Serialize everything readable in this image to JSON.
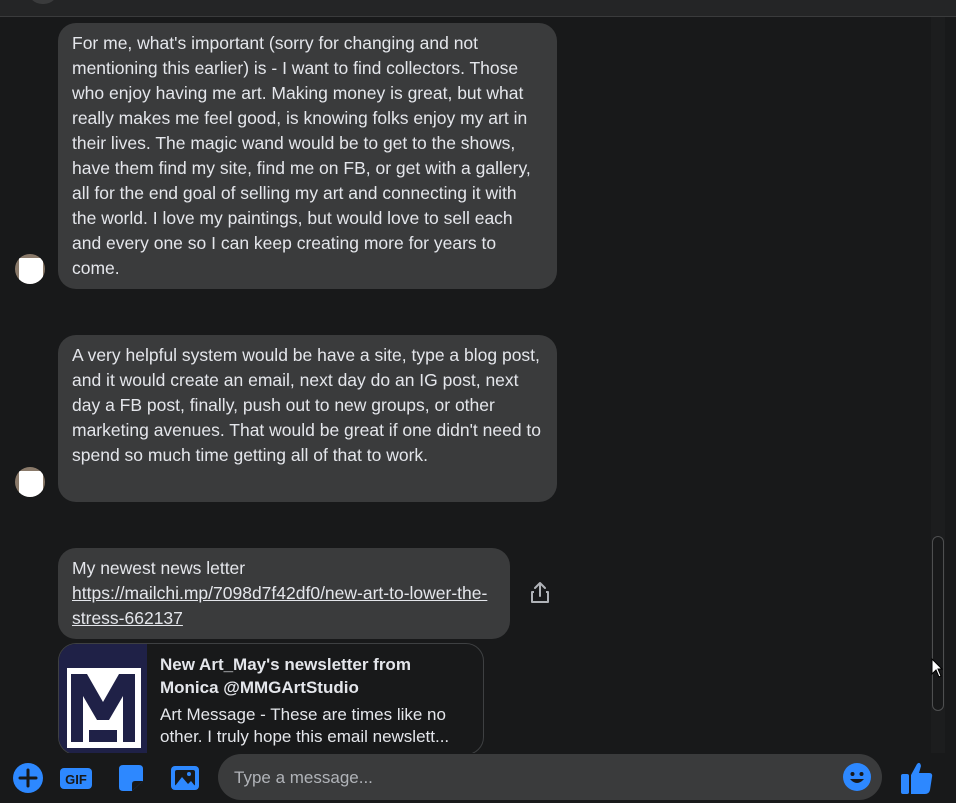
{
  "messages": [
    {
      "text": "For me, what's important (sorry for changing and not mentioning this earlier) is - I want to find collectors. Those who enjoy having me art. Making money is great, but what really makes me feel good, is knowing folks enjoy my art in their lives. The magic wand would be to get to the shows, have them find my site, find me on FB, or get with a gallery, all for the end goal of selling my art and connecting it with the world. I love my paintings, but would love to sell each and every one so I can keep creating more for years to come."
    },
    {
      "text": "A very helpful system would be have a site, type a blog post, and it would create an email, next day do an IG post, next day a FB post, finally, push out to new groups, or other marketing avenues. That would be great if one didn't need to spend so much time getting all of that to work."
    },
    {
      "text": "My newest news letter",
      "link": "https://mailchi.mp/7098d7f42df0/new-art-to-lower-the-stress-662137"
    }
  ],
  "link_preview": {
    "title": "New Art_May's newsletter from Monica @MMGArtStudio",
    "description": "Art Message - These are times like no other. I truly hope this email newslett..."
  },
  "composer": {
    "placeholder": "Type a message...",
    "gif_label": "GIF"
  },
  "colors": {
    "accent": "#2d88ff",
    "bubble": "#3a3b3c",
    "background": "#18191a"
  }
}
